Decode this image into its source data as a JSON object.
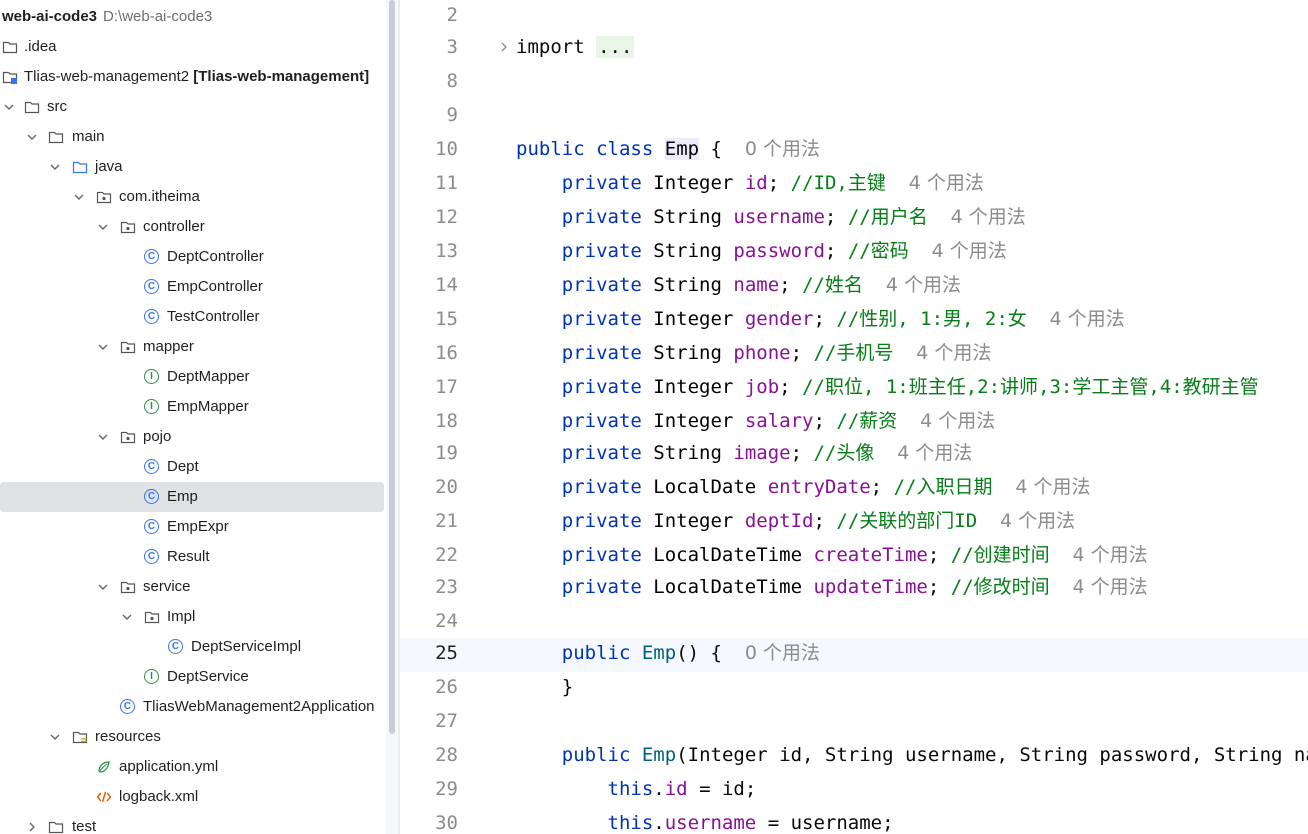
{
  "project": {
    "name": "web-ai-code3",
    "path": "D:\\web-ai-code3",
    "module_name": "Tlias-web-management2",
    "module_tag": "[Tlias-web-management]"
  },
  "tree": {
    "idea": ".idea",
    "src": "src",
    "main": "main",
    "java": "java",
    "package": "com.itheima",
    "controller": "controller",
    "dept_controller": "DeptController",
    "emp_controller": "EmpController",
    "test_controller": "TestController",
    "mapper": "mapper",
    "dept_mapper": "DeptMapper",
    "emp_mapper": "EmpMapper",
    "pojo": "pojo",
    "dept": "Dept",
    "emp": "Emp",
    "emp_expr": "EmpExpr",
    "result": "Result",
    "service": "service",
    "impl": "Impl",
    "dept_service_impl": "DeptServiceImpl",
    "dept_service": "DeptService",
    "app": "TliasWebManagement2Application",
    "resources": "resources",
    "application_yml": "application.yml",
    "logback_xml": "logback.xml",
    "test": "test",
    "class_badge": "C",
    "interface_badge": "I"
  },
  "editor": {
    "usage_0": "0 个用法",
    "usage_4": "4 个用法",
    "lines": [
      {
        "num": "2"
      },
      {
        "num": "3",
        "kw": "import",
        "ellipsis": "..."
      },
      {
        "num": "8"
      },
      {
        "num": "9"
      },
      {
        "num": "10",
        "kw1": "public",
        "kw2": "class",
        "name": "Emp",
        "rest": " {"
      },
      {
        "num": "11",
        "type": "Integer",
        "field": "id",
        "comment": "//ID,主键"
      },
      {
        "num": "12",
        "type": "String",
        "field": "username",
        "comment": "//用户名"
      },
      {
        "num": "13",
        "type": "String",
        "field": "password",
        "comment": "//密码"
      },
      {
        "num": "14",
        "type": "String",
        "field": "name",
        "comment": "//姓名"
      },
      {
        "num": "15",
        "type": "Integer",
        "field": "gender",
        "comment": "//性别, 1:男, 2:女"
      },
      {
        "num": "16",
        "type": "String",
        "field": "phone",
        "comment": "//手机号"
      },
      {
        "num": "17",
        "type": "Integer",
        "field": "job",
        "comment": "//职位, 1:班主任,2:讲师,3:学工主管,4:教研主管"
      },
      {
        "num": "18",
        "type": "Integer",
        "field": "salary",
        "comment": "//薪资"
      },
      {
        "num": "19",
        "type": "String",
        "field": "image",
        "comment": "//头像"
      },
      {
        "num": "20",
        "type": "LocalDate",
        "field": "entryDate",
        "comment": "//入职日期"
      },
      {
        "num": "21",
        "type": "Integer",
        "field": "deptId",
        "comment": "//关联的部门ID"
      },
      {
        "num": "22",
        "type": "LocalDateTime",
        "field": "createTime",
        "comment": "//创建时间"
      },
      {
        "num": "23",
        "type": "LocalDateTime",
        "field": "updateTime",
        "comment": "//修改时间"
      },
      {
        "num": "24"
      },
      {
        "num": "25",
        "kw": "public",
        "ctor": "Emp",
        "rest": "() {"
      },
      {
        "num": "26",
        "text": "}"
      },
      {
        "num": "27"
      },
      {
        "num": "28",
        "kw": "public",
        "ctor": "Emp",
        "rest": "(Integer id, String username, String password, String name"
      },
      {
        "num": "29",
        "kw": "this",
        "dot": ".",
        "field": "id",
        "rest": " = id;"
      },
      {
        "num": "30",
        "kw": "this",
        "dot": ".",
        "field": "username",
        "rest": " = username;"
      }
    ],
    "private_kw": "private",
    "semicolon": ";"
  }
}
